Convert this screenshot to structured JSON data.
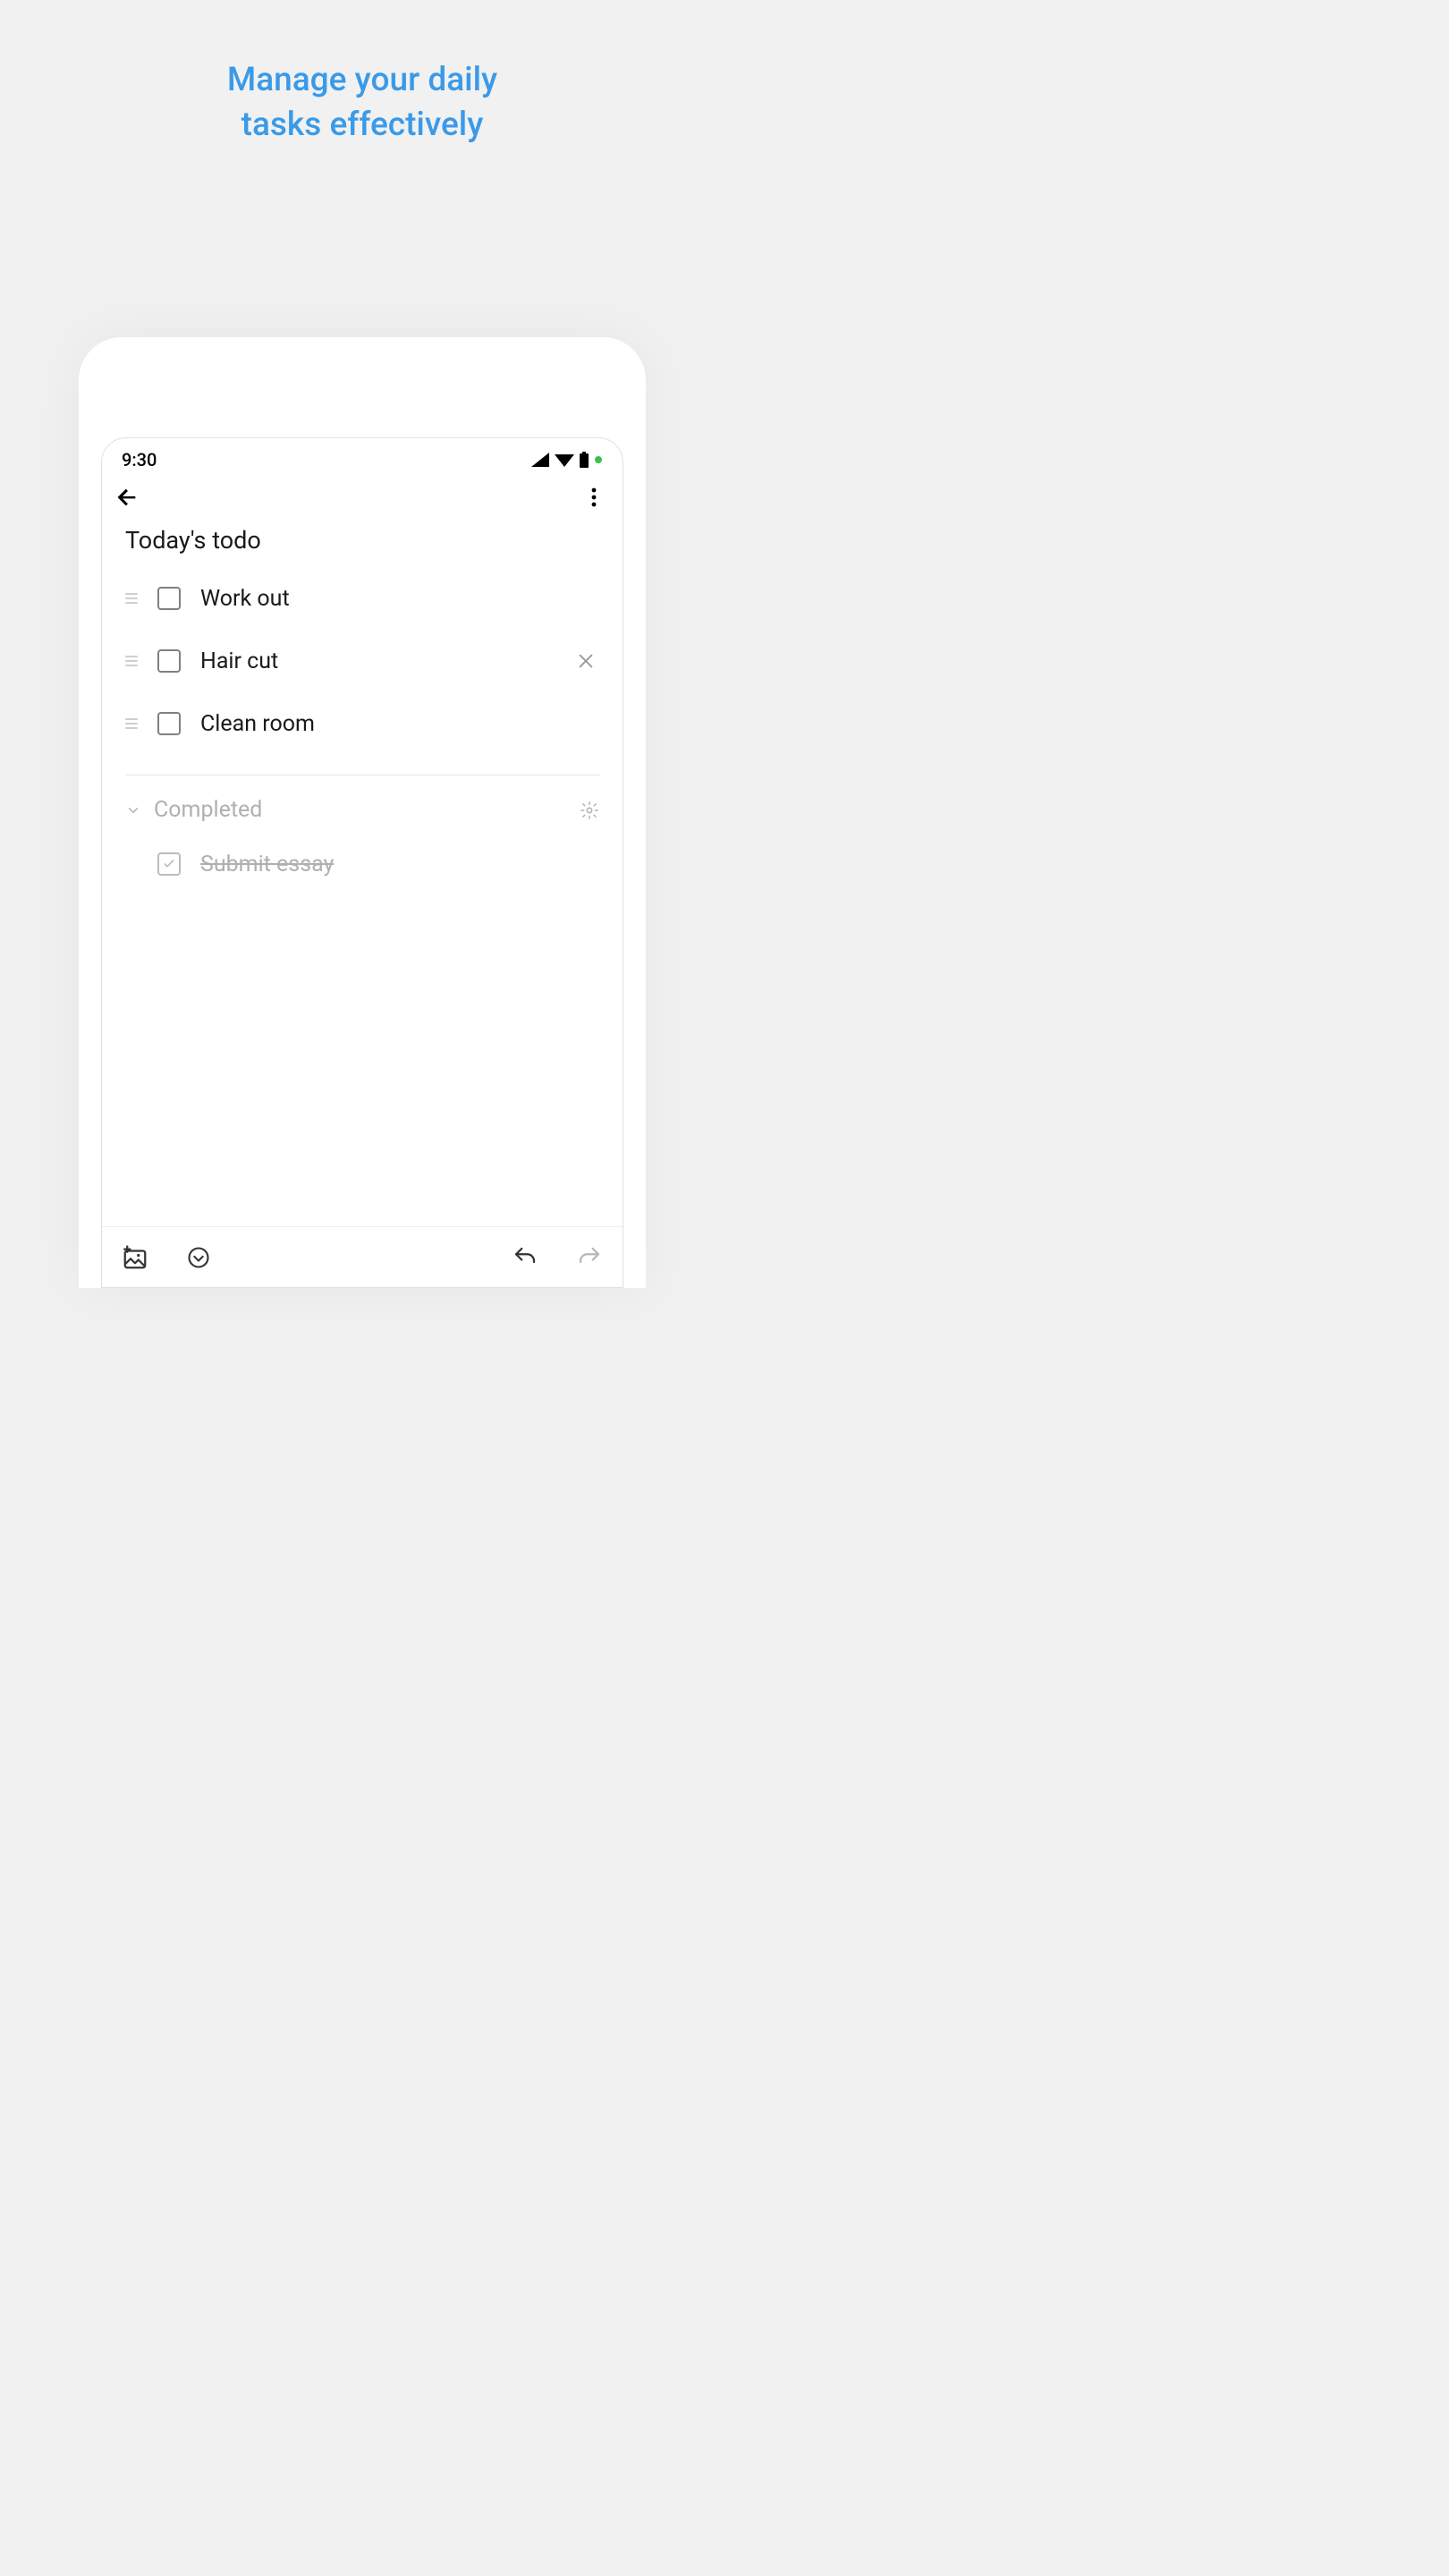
{
  "headline": {
    "line1": "Manage your daily",
    "line2": "tasks effectively"
  },
  "statusbar": {
    "time": "9:30"
  },
  "note": {
    "title": "Today's todo",
    "tasks": [
      {
        "label": "Work out"
      },
      {
        "label": "Hair cut"
      },
      {
        "label": "Clean room"
      }
    ],
    "completed_section": {
      "label": "Completed",
      "items": [
        {
          "label": "Submit essay"
        }
      ]
    }
  },
  "colors": {
    "accent": "#3A9AE8"
  }
}
